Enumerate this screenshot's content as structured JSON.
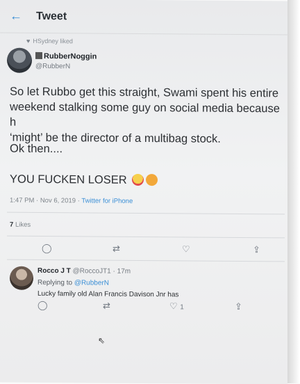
{
  "header": {
    "back_icon": "←",
    "title": "Tweet"
  },
  "social_context": {
    "heart_icon": "♥",
    "text": "HSydney liked"
  },
  "author": {
    "name": "RubberNoggin",
    "handle": "@RubberN"
  },
  "tweet": {
    "line1": "So let Rubbo get this straight, Swami spent his entire",
    "line2": "weekend stalking some guy on social media because h",
    "line3": "‘might’ be the director of a multibag stock.",
    "line4": "Ok then....",
    "line5": "YOU FUCKEN LOSER"
  },
  "meta": {
    "timestamp": "1:47 PM · Nov 6, 2019 · ",
    "source": "Twitter for iPhone"
  },
  "likes": {
    "count": "7",
    "label": "Likes"
  },
  "actions": {
    "reply": "◯",
    "retweet": "⇄",
    "like": "♡",
    "share": "⇪"
  },
  "reply": {
    "name": "Rocco J T",
    "handle_time": "@RoccoJT1 · 17m",
    "replying_prefix": "Replying to ",
    "replying_to": "@RubberN",
    "text": "Lucky family old Alan Francis Davison Jnr has",
    "like_count": "1"
  },
  "cursor_icon": "⇖"
}
